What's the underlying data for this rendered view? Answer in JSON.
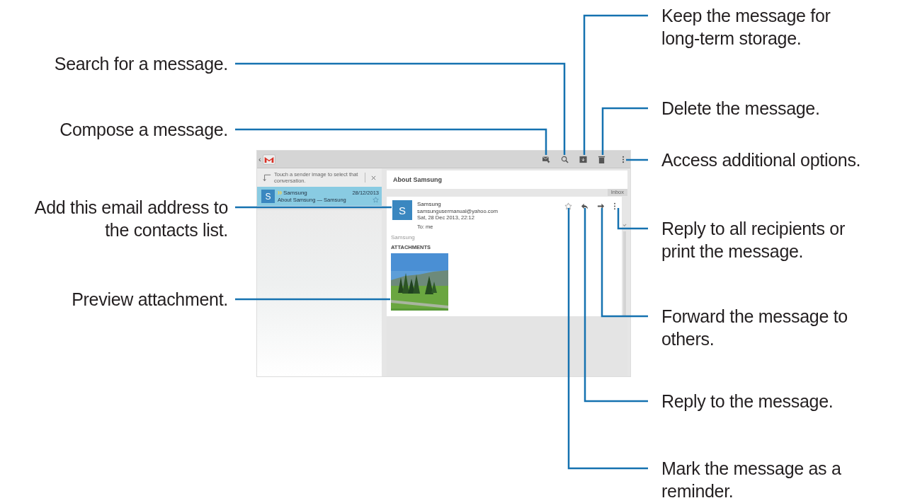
{
  "callouts_left": [
    {
      "lines": [
        "Search for a message."
      ]
    },
    {
      "lines": [
        "Compose a message."
      ]
    },
    {
      "lines": [
        "Add this email address to",
        "the contacts list."
      ]
    },
    {
      "lines": [
        "Preview attachment."
      ]
    }
  ],
  "callouts_right": [
    {
      "lines": [
        "Keep the message for",
        "long-term storage."
      ]
    },
    {
      "lines": [
        "Delete the message."
      ]
    },
    {
      "lines": [
        "Access additional options."
      ]
    },
    {
      "lines": [
        "Reply to all recipients or",
        "print the message."
      ]
    },
    {
      "lines": [
        "Forward the message to",
        "others."
      ]
    },
    {
      "lines": [
        "Reply to the message."
      ]
    },
    {
      "lines": [
        "Mark the message as a",
        "reminder."
      ]
    }
  ],
  "screen": {
    "top_bar": {
      "back": "‹"
    },
    "hint": "Touch a sender image to select that conversation.",
    "conversations": [
      {
        "avatar": "S",
        "sender": "Samsung",
        "subject": "About Samsung — Samsung",
        "date": "28/12/2013",
        "selected": true
      }
    ],
    "message": {
      "subject": "About Samsung",
      "folder": "Inbox",
      "avatar": "S",
      "sender": "Samsung",
      "email": "samsungusermanual@yahoo.com",
      "date": "Sat, 28 Dec 2013, 22:12",
      "to": "To: me",
      "body": "Samsung",
      "attachments_heading": "ATTACHMENTS"
    }
  }
}
